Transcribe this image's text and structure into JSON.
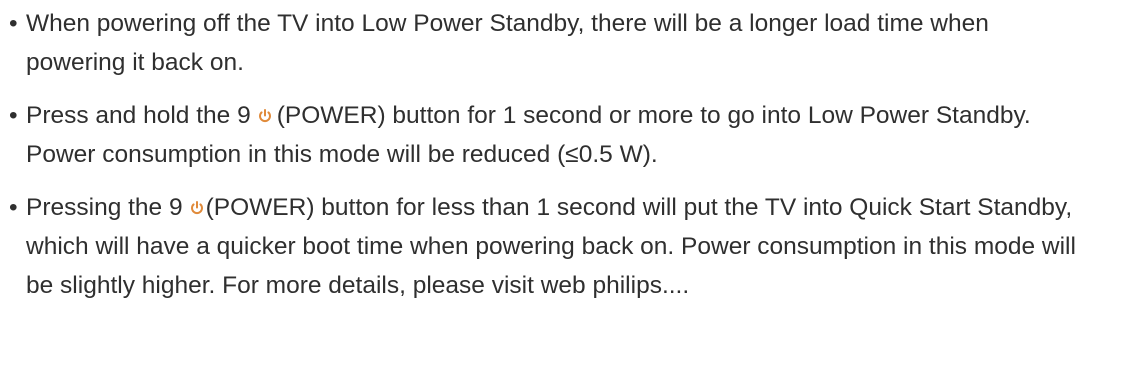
{
  "bullets": [
    {
      "marker": "•",
      "text": "When powering off the TV into Low Power Standby, there will be a longer load time when powering it back on."
    },
    {
      "marker": "•",
      "before": "Press and hold the 9",
      "icon": "power-icon",
      "after": "(POWER) button for 1 second or more to go into Low Power Standby. Power consumption in this mode will be reduced (≤0.5 W)."
    },
    {
      "marker": "•",
      "before": "Pressing the 9",
      "icon": "power-icon",
      "after": "(POWER) button for less than 1 second will put the TV into Quick Start Standby, which will have a quicker boot time when powering back on. Power consumption in this mode will be slightly higher. For more details, please visit web philips...."
    }
  ],
  "colors": {
    "text": "#2f2f2f",
    "icon": "#e08a3a"
  }
}
